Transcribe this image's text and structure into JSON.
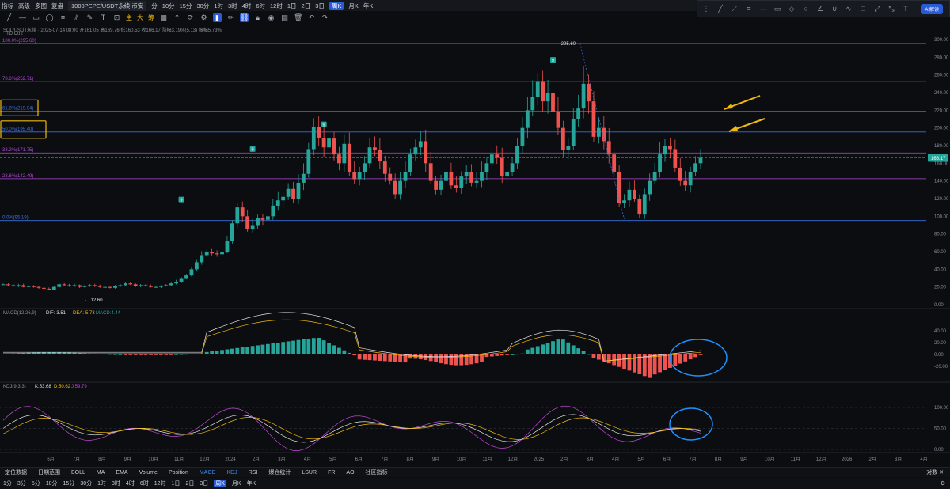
{
  "topbar": {
    "items": [
      "指标",
      "高级",
      "多图",
      "复盘"
    ],
    "symbol": "1000PEPE/USDT永续 币安",
    "intervals": [
      "分",
      "10分",
      "15分",
      "30分",
      "1时",
      "3时",
      "4时",
      "6时",
      "12时",
      "1日",
      "2日",
      "3日",
      "周K",
      "月K",
      "年K"
    ],
    "active_interval": "周K"
  },
  "right_tools": {
    "ai_label": "AI解读"
  },
  "chart_info": {
    "line1": "SOL/USDT永续 · 2025-07-14 08:00 开161.05 高169.76 低160.53 收166.17 涨幅3.19%(5.13) 振幅5.73%",
    "line2": "TD Ctr2"
  },
  "toolbar": {
    "chinese_buttons": [
      "主",
      "大",
      "筹"
    ]
  },
  "colors": {
    "up": "#26a69a",
    "down": "#ef5350",
    "fib": "#b04bd6",
    "fib_blue": "#3f6fd9",
    "yellow": "#f0b90b",
    "circle": "#1e90ff"
  },
  "fib_levels": [
    {
      "label": "100.0%(295.60)",
      "price": 295.6,
      "color": "#b04bd6"
    },
    {
      "label": "78.6%(252.71)",
      "price": 252.71,
      "color": "#b04bd6"
    },
    {
      "label": "61.8%(219.04)",
      "price": 219.04,
      "color": "#3f6fd9"
    },
    {
      "label": "50.0%(195.40)",
      "price": 195.4,
      "color": "#3f6fd9"
    },
    {
      "label": "38.2%(171.75)",
      "price": 171.75,
      "color": "#b04bd6"
    },
    {
      "label": "23.6%(142.49)",
      "price": 142.49,
      "color": "#b04bd6"
    },
    {
      "label": "0.0%(95.19)",
      "price": 95.19,
      "color": "#3f6fd9"
    }
  ],
  "price_axis": [
    "300.00",
    "280.00",
    "260.00",
    "240.00",
    "220.00",
    "200.00",
    "180.00",
    "160.00",
    "140.00",
    "120.00",
    "100.00",
    "80.00",
    "60.00",
    "40.00",
    "20.00",
    "0.00"
  ],
  "current_price": "166.17",
  "markers": {
    "high": "295.60",
    "low": "12.60"
  },
  "td_markers": [
    "9",
    "9",
    "9",
    "9"
  ],
  "macd": {
    "label": "MACD(12,26,9)",
    "dif": "DIF:-3.51",
    "dea": "DEA:-5.73",
    "macd": "MACD:4.44",
    "axis": [
      "40.00",
      "20.00",
      "0.00",
      "-20.00"
    ]
  },
  "kdj": {
    "label": "KDJ(9,3,3)",
    "k": "K:53.68",
    "d": "D:50.62",
    "j": "J:59.79",
    "axis": [
      "100.00",
      "50.00",
      "0.00"
    ]
  },
  "time_axis": [
    "6月",
    "7月",
    "8月",
    "9月",
    "10月",
    "11月",
    "12月",
    "2024",
    "2月",
    "3月",
    "4月",
    "5月",
    "6月",
    "7月",
    "8月",
    "9月",
    "10月",
    "11月",
    "12月",
    "2025",
    "2月",
    "3月",
    "4月",
    "5月",
    "6月",
    "7月",
    "8月",
    "9月",
    "10月",
    "11月",
    "12月",
    "2026",
    "2月",
    "3月",
    "4月"
  ],
  "bottom_bar": {
    "items": [
      "定位数据",
      "日期范围",
      "BOLL",
      "MA",
      "EMA",
      "Volume",
      "Position",
      "MACD",
      "KDJ",
      "RSI",
      "爆仓统计",
      "LSUR",
      "FR",
      "AO",
      "社区指标"
    ],
    "active": [
      "MACD",
      "KDJ"
    ],
    "right": "对数 ✕"
  },
  "interval_bar": {
    "items": [
      "1分",
      "3分",
      "5分",
      "10分",
      "15分",
      "30分",
      "1时",
      "3时",
      "4时",
      "6时",
      "12时",
      "1日",
      "2日",
      "3日",
      "周K",
      "月K",
      "年K"
    ],
    "active": "周K"
  }
}
